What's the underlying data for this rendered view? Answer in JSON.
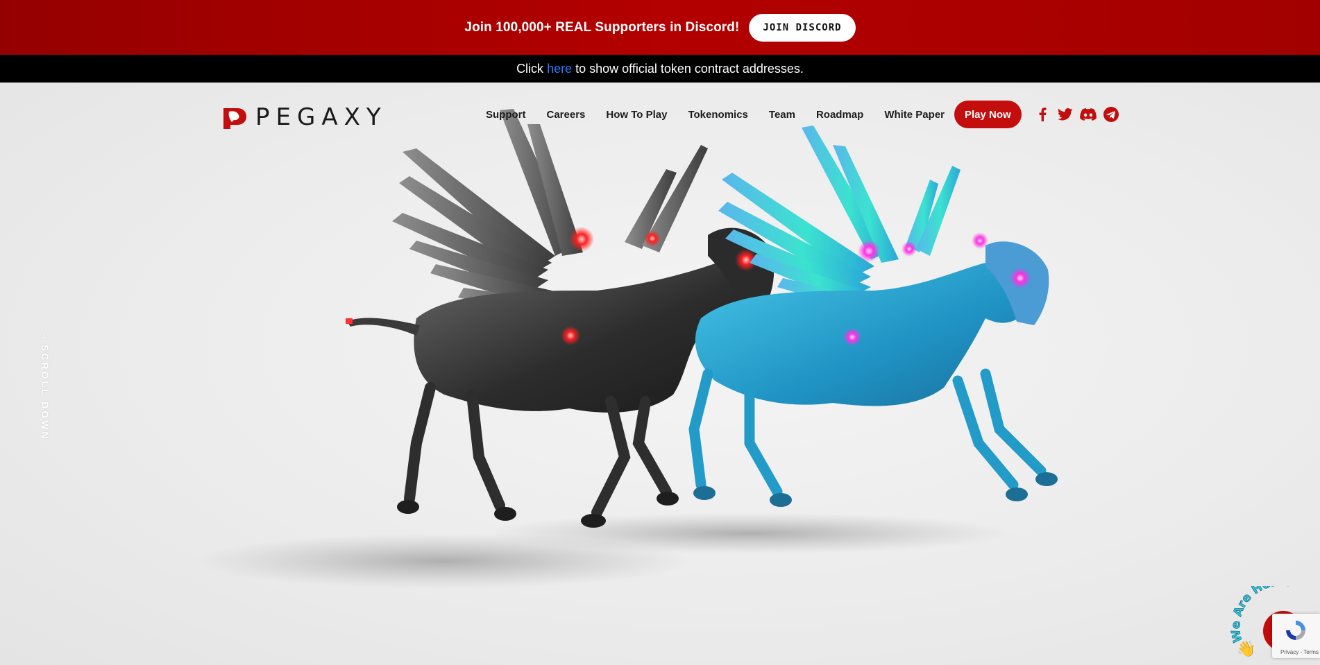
{
  "promo": {
    "text": "Join 100,000+ REAL Supporters in Discord!",
    "button": "Join Discord"
  },
  "notice": {
    "before": "Click",
    "link": "here",
    "after": "to show official token contract addresses."
  },
  "brand": {
    "name": "PEGAXY"
  },
  "nav": {
    "items": [
      "Support",
      "Careers",
      "How To Play",
      "Tokenomics",
      "Team",
      "Roadmap",
      "White Paper"
    ],
    "cta": "Play Now",
    "socials": [
      "facebook-icon",
      "twitter-icon",
      "discord-icon",
      "telegram-icon"
    ]
  },
  "hero": {
    "scroll_label": "SCROLL DOWN"
  },
  "chat": {
    "badge": "We Are Here!",
    "recaptcha_terms": "Privacy - Terms"
  },
  "colors": {
    "brand_red": "#c40d0d",
    "promo_red": "#a80000",
    "link_blue": "#2f7bff"
  }
}
